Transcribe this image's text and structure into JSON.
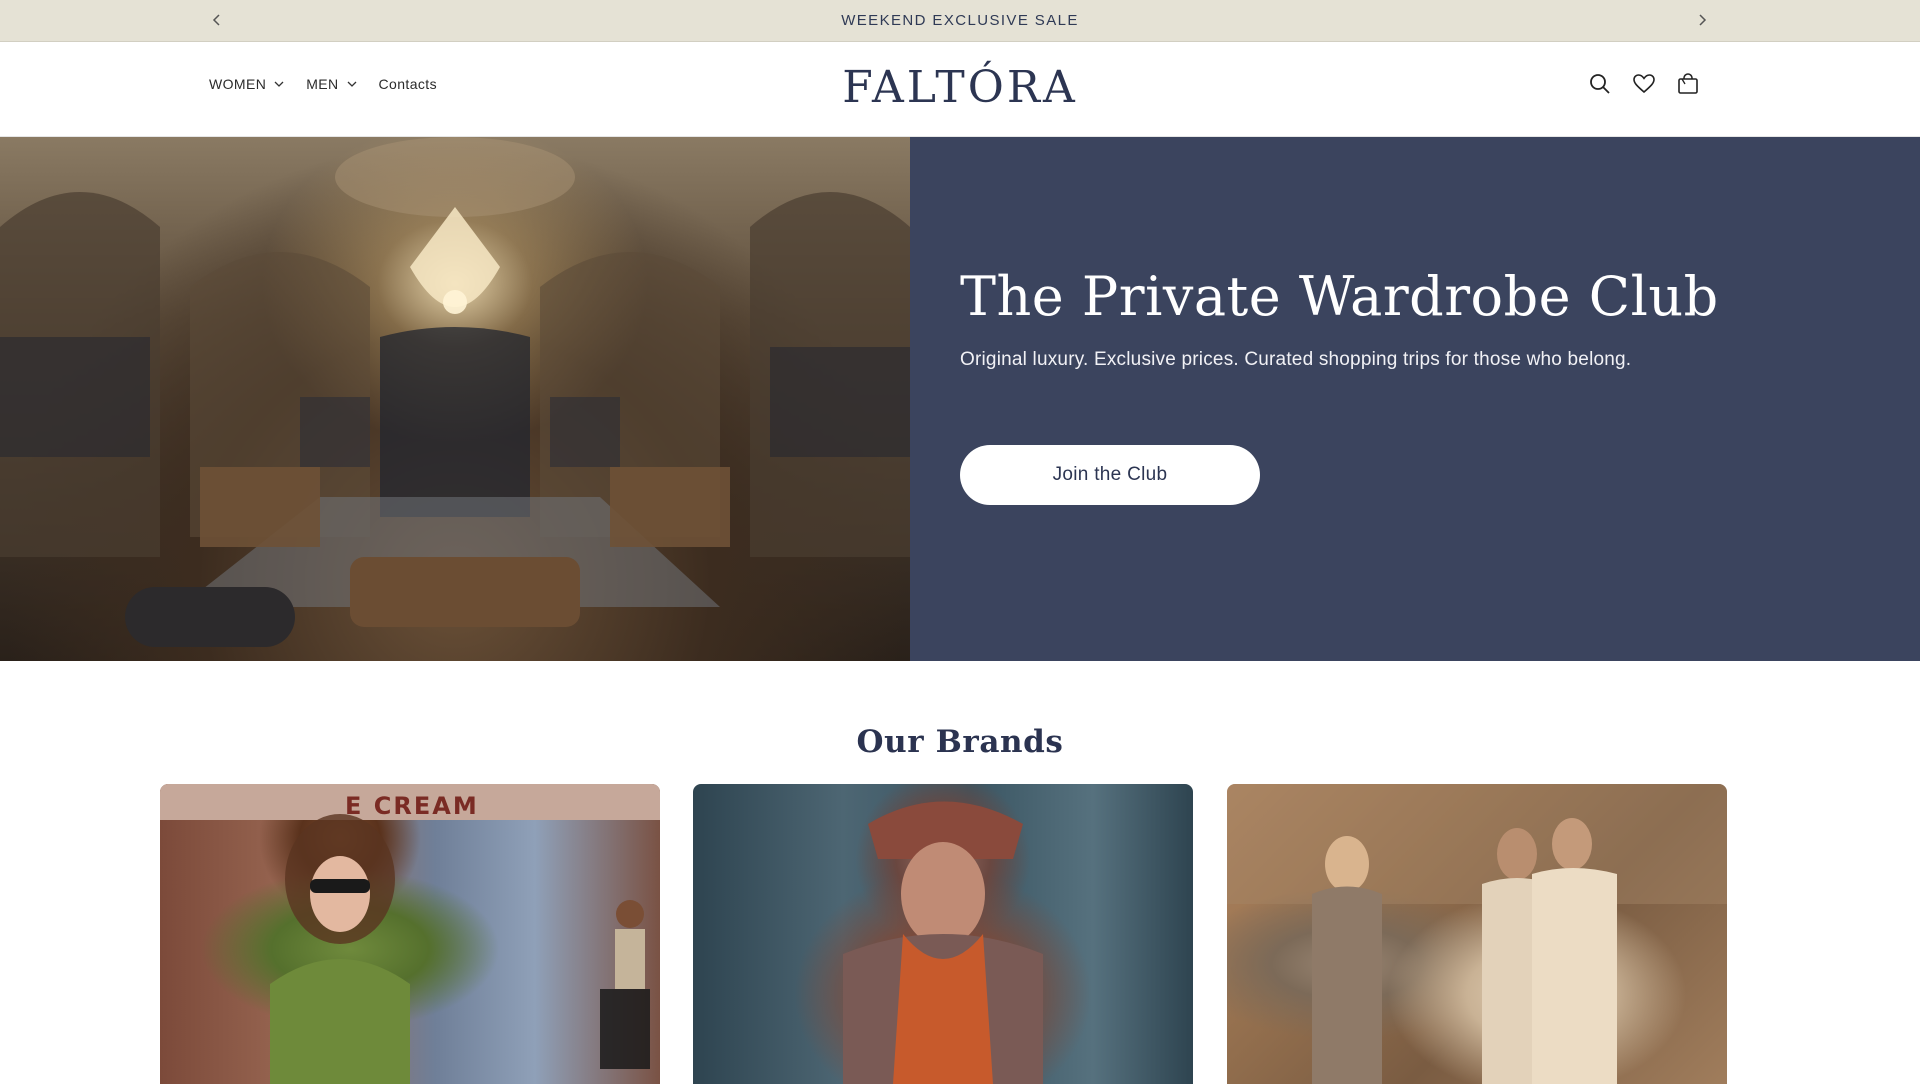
{
  "announcement": {
    "text": "WEEKEND EXCLUSIVE SALE",
    "prev_icon": "chevron-left-icon",
    "next_icon": "chevron-right-icon"
  },
  "header": {
    "logo": "FALTÓRA",
    "nav": [
      {
        "label": "WOMEN",
        "has_dropdown": true
      },
      {
        "label": "MEN",
        "has_dropdown": true
      },
      {
        "label": "Contacts",
        "has_dropdown": false
      }
    ],
    "icons": [
      "search-icon",
      "heart-icon",
      "bag-icon"
    ]
  },
  "hero": {
    "title": "The Private Wardrobe Club",
    "subtitle": "Original luxury. Exclusive prices. Curated shopping trips for those who belong.",
    "button_label": "Join the Club",
    "panel_color": "#3b445e"
  },
  "brands": {
    "title": "Our Brands",
    "cards": [
      {
        "image_text": "E CREAM"
      },
      {
        "image_text": ""
      },
      {
        "image_text": ""
      }
    ]
  },
  "colors": {
    "announcement_bg": "#e5e2d5",
    "brand_navy": "#2c3552",
    "hero_panel": "#3b445e"
  }
}
